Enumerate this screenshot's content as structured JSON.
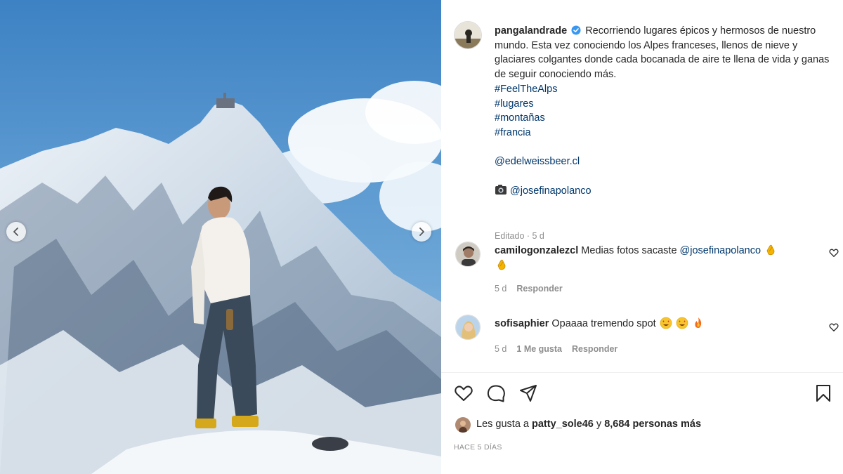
{
  "post": {
    "username": "pangalandrade",
    "caption_text": "Recorriendo lugares épicos y hermosos de nuestro mundo. Esta vez conociendo los Alpes franceses, llenos de nieve y glaciares colgantes donde cada bocanada de aire te llena de vida y ganas de seguir conociendo más.",
    "hashtags": [
      "#FeelTheAlps",
      "#lugares",
      "#montañas",
      "#francia"
    ],
    "mention_brand": "@edelweissbeer.cl",
    "photo_credit_mention": "@josefinapolanco",
    "edited_label": "Editado · 5 d"
  },
  "comments": [
    {
      "username": "camilogonzalezcl",
      "text": "Medias fotos sacaste",
      "mention": "@josefinapolanco",
      "time": "5 d",
      "reply_label": "Responder"
    },
    {
      "username": "sofisaphier",
      "text": "Opaaaa tremendo spot",
      "time": "5 d",
      "likes_label": "1 Me gusta",
      "reply_label": "Responder"
    }
  ],
  "likes": {
    "prefix": "Les gusta a",
    "user": "patty_sole46",
    "connector": "y",
    "count_text": "8,684 personas más"
  },
  "timestamp": "HACE 5 DÍAS",
  "icons": {
    "verified": "verified-badge-icon",
    "camera": "camera-icon",
    "clap": "clapping-hands-icon",
    "heart_eyes": "heart-eyes-emoji-icon",
    "fire": "fire-icon",
    "like": "heart-icon",
    "comment": "comment-icon",
    "share": "send-icon",
    "save": "bookmark-icon"
  },
  "colors": {
    "link": "#00376b",
    "verified": "#3897f0",
    "muted": "#8e8e8e"
  }
}
